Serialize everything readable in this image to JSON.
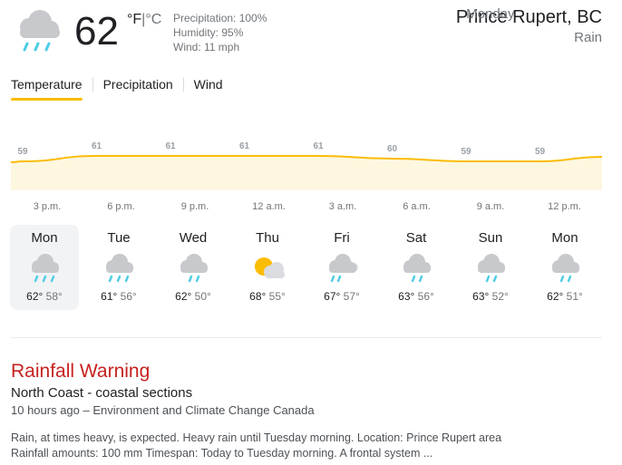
{
  "current": {
    "icon": "rain-cloud-icon",
    "temperature": "62",
    "unit_f": "°F",
    "unit_sep": "|",
    "unit_c": "°C",
    "precipitation": "Precipitation: 100%",
    "humidity": "Humidity: 95%",
    "wind": "Wind: 11 mph"
  },
  "location": {
    "city": "Prince Rupert, BC",
    "day": "Monday",
    "condition": "Rain"
  },
  "tabs": [
    {
      "label": "Temperature",
      "active": true
    },
    {
      "label": "Precipitation",
      "active": false
    },
    {
      "label": "Wind",
      "active": false
    }
  ],
  "chart_data": {
    "type": "area",
    "unit": "°F",
    "x": [
      "3 p.m.",
      "6 p.m.",
      "9 p.m.",
      "12 a.m.",
      "3 a.m.",
      "6 a.m.",
      "9 a.m.",
      "12 p.m."
    ],
    "values": [
      59,
      61,
      61,
      61,
      61,
      60,
      59,
      59
    ],
    "labels": [
      "59",
      "61",
      "61",
      "61",
      "61",
      "60",
      "59",
      "59"
    ],
    "color": "#fbbc04",
    "fill": "#fef7e0"
  },
  "forecast": [
    {
      "day": "Mon",
      "icon": "heavy-rain-icon",
      "high": "62°",
      "low": "58°",
      "selected": true
    },
    {
      "day": "Tue",
      "icon": "heavy-rain-icon",
      "high": "61°",
      "low": "56°",
      "selected": false
    },
    {
      "day": "Wed",
      "icon": "rain-icon",
      "high": "62°",
      "low": "50°",
      "selected": false
    },
    {
      "day": "Thu",
      "icon": "partly-sunny-icon",
      "high": "68°",
      "low": "55°",
      "selected": false
    },
    {
      "day": "Fri",
      "icon": "showers-icon",
      "high": "67°",
      "low": "57°",
      "selected": false
    },
    {
      "day": "Sat",
      "icon": "rain-icon",
      "high": "63°",
      "low": "56°",
      "selected": false
    },
    {
      "day": "Sun",
      "icon": "rain-icon",
      "high": "63°",
      "low": "52°",
      "selected": false
    },
    {
      "day": "Mon",
      "icon": "rain-icon",
      "high": "62°",
      "low": "51°",
      "selected": false
    }
  ],
  "warning": {
    "title": "Rainfall Warning",
    "region": "North Coast - coastal sections",
    "meta": "10 hours ago – Environment and Climate Change Canada",
    "body_line1": "Rain, at times heavy, is expected. Heavy rain until Tuesday morning. Location: Prince Rupert area",
    "body_line2": "Rainfall amounts: 100 mm Timespan: Today to Tuesday morning. A frontal system ..."
  }
}
